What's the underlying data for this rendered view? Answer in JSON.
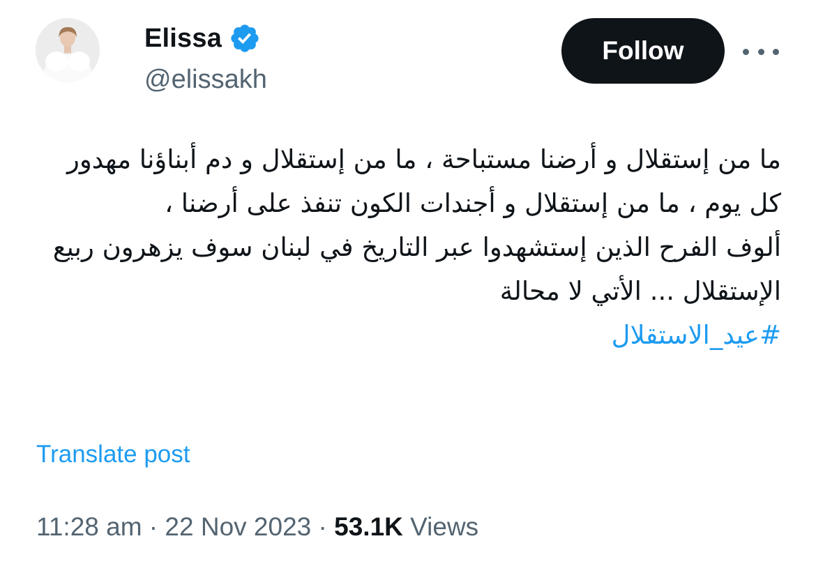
{
  "author": {
    "display_name": "Elissa",
    "handle": "@elissakh",
    "verified": true
  },
  "actions": {
    "follow_label": "Follow"
  },
  "tweet": {
    "paragraph_1": "ما من إستقلال و أرضنا مستباحة ، ما من إستقلال و دم أبناؤنا مهدور كل يوم  ، ما من إستقلال و أجندات الكون تنفذ على أرضنا ،",
    "paragraph_2": "ألوف الفرح الذين إستشهدوا عبر التاريخ في لبنان سوف يزهرون ربيع الإستقلال ... الأتي لا محالة",
    "hashtag": "#عيد_الاستقلال"
  },
  "translate_label": "Translate post",
  "meta": {
    "time": "11:28 am",
    "separator_1": " · ",
    "date": "22 Nov 2023",
    "separator_2": " · ",
    "views_count": "53.1K",
    "views_label": " Views"
  },
  "colors": {
    "text": "#0f1419",
    "secondary": "#536471",
    "link": "#1d9bf0",
    "verified_badge": "#1d9bf0",
    "follow_bg": "#0f1419"
  }
}
